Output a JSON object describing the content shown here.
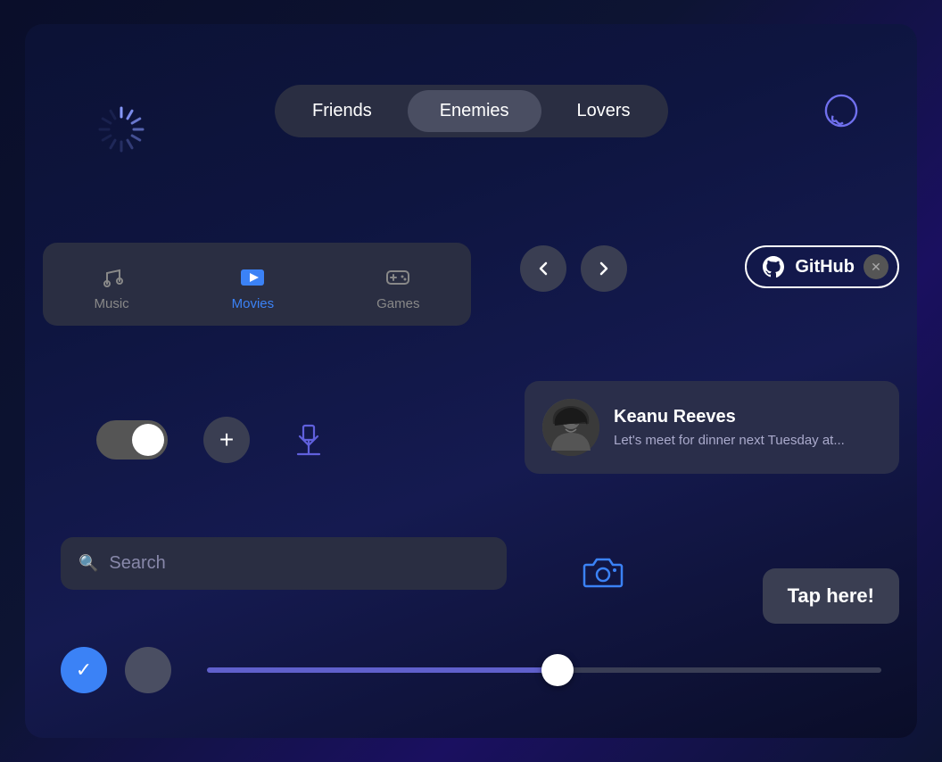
{
  "tabs": {
    "items": [
      {
        "label": "Friends",
        "active": false
      },
      {
        "label": "Enemies",
        "active": true
      },
      {
        "label": "Lovers",
        "active": false
      }
    ]
  },
  "chat_icon": {
    "label": "chat"
  },
  "media_tabs": {
    "items": [
      {
        "label": "Music",
        "active": false,
        "icon": "music"
      },
      {
        "label": "Movies",
        "active": true,
        "icon": "movies"
      },
      {
        "label": "Games",
        "active": false,
        "icon": "games"
      }
    ]
  },
  "nav": {
    "back_label": "<",
    "forward_label": ">"
  },
  "github_pill": {
    "label": "GitHub"
  },
  "message": {
    "name": "Keanu Reeves",
    "text": "Let's meet for dinner next Tuesday at..."
  },
  "search": {
    "placeholder": "Search"
  },
  "tap_button": {
    "label": "Tap here!"
  },
  "slider": {
    "value": 52
  },
  "colors": {
    "accent_blue": "#3b82f6",
    "accent_purple": "#6060dd",
    "bg_card": "#2a2e42",
    "bg_dark": "#1a1e32"
  }
}
